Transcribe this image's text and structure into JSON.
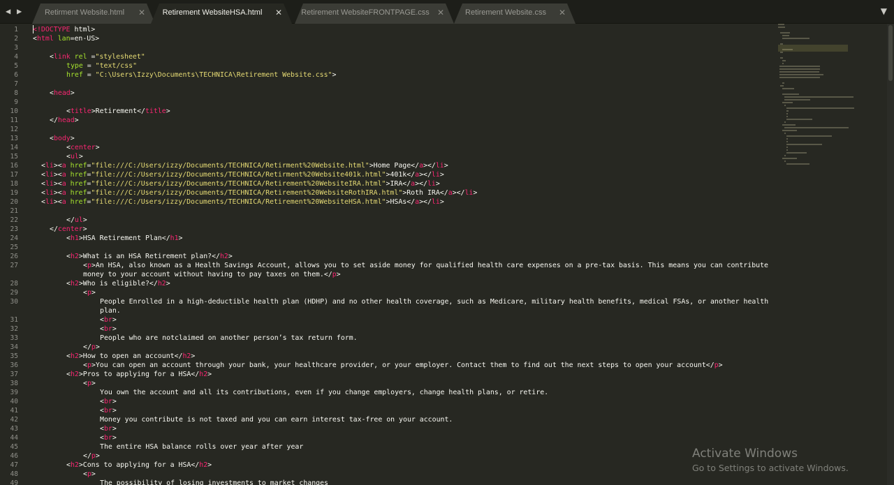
{
  "tabs": [
    {
      "label": "Retirment Website.html",
      "active": false
    },
    {
      "label": "Retirement WebsiteHSA.html",
      "active": true
    },
    {
      "label": "Retirement WebsiteFRONTPAGE.css",
      "active": false
    },
    {
      "label": "Retirement Website.css",
      "active": false
    }
  ],
  "colors": {
    "background": "#272822",
    "tag": "#f92672",
    "string": "#e6db74",
    "attribute": "#a6e22e",
    "text": "#f8f8f2",
    "line_number": "#90908a"
  },
  "icons": {
    "back": "chevron-left-icon",
    "forward": "chevron-right-icon",
    "close": "close-icon",
    "tab_menu": "chevron-down-icon"
  },
  "code_lines": [
    {
      "n": "1",
      "indent": 0,
      "tokens": [
        [
          "t",
          "<!"
        ],
        [
          "t",
          "DOCTYPE"
        ],
        [
          "p",
          " html>"
        ]
      ]
    },
    {
      "n": "2",
      "indent": 0,
      "tokens": [
        [
          "p",
          "<"
        ],
        [
          "t",
          "html"
        ],
        [
          "a",
          " lan"
        ],
        [
          "p",
          "=en-US>"
        ]
      ]
    },
    {
      "n": "3",
      "indent": 0,
      "tokens": []
    },
    {
      "n": "4",
      "indent": 2,
      "tokens": [
        [
          "p",
          "<"
        ],
        [
          "t",
          "link"
        ],
        [
          "a",
          " rel"
        ],
        [
          "p",
          " ="
        ],
        [
          "s",
          "\"stylesheet\""
        ]
      ]
    },
    {
      "n": "5",
      "indent": 4,
      "tokens": [
        [
          "a",
          "type"
        ],
        [
          "p",
          " = "
        ],
        [
          "s",
          "\"text/css\""
        ]
      ]
    },
    {
      "n": "6",
      "indent": 4,
      "tokens": [
        [
          "a",
          "href"
        ],
        [
          "p",
          " = "
        ],
        [
          "s",
          "\"C:\\Users\\Izzy\\Documents\\TECHNICA\\Retirement Website.css\""
        ],
        [
          "p",
          ">"
        ]
      ]
    },
    {
      "n": "7",
      "indent": 0,
      "tokens": []
    },
    {
      "n": "8",
      "indent": 2,
      "tokens": [
        [
          "p",
          "<"
        ],
        [
          "t",
          "head"
        ],
        [
          "p",
          ">"
        ]
      ]
    },
    {
      "n": "9",
      "indent": 0,
      "tokens": []
    },
    {
      "n": "10",
      "indent": 4,
      "tokens": [
        [
          "p",
          "<"
        ],
        [
          "t",
          "title"
        ],
        [
          "p",
          ">Retirement</"
        ],
        [
          "t",
          "title"
        ],
        [
          "p",
          ">"
        ]
      ]
    },
    {
      "n": "11",
      "indent": 2,
      "tokens": [
        [
          "p",
          "</"
        ],
        [
          "t",
          "head"
        ],
        [
          "p",
          ">"
        ]
      ]
    },
    {
      "n": "12",
      "indent": 0,
      "tokens": []
    },
    {
      "n": "13",
      "indent": 2,
      "tokens": [
        [
          "p",
          "<"
        ],
        [
          "t",
          "body"
        ],
        [
          "p",
          ">"
        ]
      ]
    },
    {
      "n": "14",
      "indent": 4,
      "tokens": [
        [
          "p",
          "<"
        ],
        [
          "t",
          "center"
        ],
        [
          "p",
          ">"
        ]
      ]
    },
    {
      "n": "15",
      "indent": 4,
      "tokens": [
        [
          "p",
          "<"
        ],
        [
          "t",
          "ul"
        ],
        [
          "p",
          ">"
        ]
      ]
    },
    {
      "n": "16",
      "indent": 1,
      "tokens": [
        [
          "p",
          "<"
        ],
        [
          "t",
          "li"
        ],
        [
          "p",
          "><"
        ],
        [
          "t",
          "a"
        ],
        [
          "a",
          " href"
        ],
        [
          "p",
          "="
        ],
        [
          "s",
          "\"file:///C:/Users/izzy/Documents/TECHNICA/Retirment%20Website.html\""
        ],
        [
          "p",
          ">Home Page</"
        ],
        [
          "t",
          "a"
        ],
        [
          "p",
          "></"
        ],
        [
          "t",
          "li"
        ],
        [
          "p",
          ">"
        ]
      ]
    },
    {
      "n": "17",
      "indent": 1,
      "tokens": [
        [
          "p",
          "<"
        ],
        [
          "t",
          "li"
        ],
        [
          "p",
          "><"
        ],
        [
          "t",
          "a"
        ],
        [
          "a",
          " href"
        ],
        [
          "p",
          "="
        ],
        [
          "s",
          "\"file:///C:/Users/izzy/Documents/TECHNICA/Retirment%20Website401k.html\""
        ],
        [
          "p",
          ">401k</"
        ],
        [
          "t",
          "a"
        ],
        [
          "p",
          "></"
        ],
        [
          "t",
          "li"
        ],
        [
          "p",
          ">"
        ]
      ]
    },
    {
      "n": "18",
      "indent": 1,
      "tokens": [
        [
          "p",
          "<"
        ],
        [
          "t",
          "li"
        ],
        [
          "p",
          "><"
        ],
        [
          "t",
          "a"
        ],
        [
          "a",
          " href"
        ],
        [
          "p",
          "="
        ],
        [
          "s",
          "\"file:///C:/Users/izzy/Documents/TECHNICA/Retirement%20WebsiteIRA.html\""
        ],
        [
          "p",
          ">IRA</"
        ],
        [
          "t",
          "a"
        ],
        [
          "p",
          "></"
        ],
        [
          "t",
          "li"
        ],
        [
          "p",
          ">"
        ]
      ]
    },
    {
      "n": "19",
      "indent": 1,
      "tokens": [
        [
          "p",
          "<"
        ],
        [
          "t",
          "li"
        ],
        [
          "p",
          "><"
        ],
        [
          "t",
          "a"
        ],
        [
          "a",
          " href"
        ],
        [
          "p",
          "="
        ],
        [
          "s",
          "\"file:///C:/Users/izzy/Documents/TECHNICA/Retirement%20WebsiteRothIRA.html\""
        ],
        [
          "p",
          ">Roth IRA</"
        ],
        [
          "t",
          "a"
        ],
        [
          "p",
          "></"
        ],
        [
          "t",
          "li"
        ],
        [
          "p",
          ">"
        ]
      ]
    },
    {
      "n": "20",
      "indent": 1,
      "tokens": [
        [
          "p",
          "<"
        ],
        [
          "t",
          "li"
        ],
        [
          "p",
          "><"
        ],
        [
          "t",
          "a"
        ],
        [
          "a",
          " href"
        ],
        [
          "p",
          "="
        ],
        [
          "s",
          "\"file:///C:/Users/izzy/Documents/TECHNICA/Retirement%20WebsiteHSA.html\""
        ],
        [
          "p",
          ">HSAs</"
        ],
        [
          "t",
          "a"
        ],
        [
          "p",
          "></"
        ],
        [
          "t",
          "li"
        ],
        [
          "p",
          ">"
        ]
      ]
    },
    {
      "n": "21",
      "indent": 0,
      "tokens": []
    },
    {
      "n": "22",
      "indent": 4,
      "tokens": [
        [
          "p",
          "</"
        ],
        [
          "t",
          "ul"
        ],
        [
          "p",
          ">"
        ]
      ]
    },
    {
      "n": "23",
      "indent": 2,
      "tokens": [
        [
          "p",
          "</"
        ],
        [
          "t",
          "center"
        ],
        [
          "p",
          ">"
        ]
      ]
    },
    {
      "n": "24",
      "indent": 4,
      "tokens": [
        [
          "p",
          "<"
        ],
        [
          "t",
          "h1"
        ],
        [
          "p",
          ">HSA Retirement Plan</"
        ],
        [
          "t",
          "h1"
        ],
        [
          "p",
          ">"
        ]
      ]
    },
    {
      "n": "25",
      "indent": 0,
      "tokens": []
    },
    {
      "n": "26",
      "indent": 4,
      "tokens": [
        [
          "p",
          "<"
        ],
        [
          "t",
          "h2"
        ],
        [
          "p",
          ">What is an HSA Retirement plan?</"
        ],
        [
          "t",
          "h2"
        ],
        [
          "p",
          ">"
        ]
      ]
    },
    {
      "n": "27",
      "indent": 6,
      "tokens": [
        [
          "p",
          "<"
        ],
        [
          "t",
          "p"
        ],
        [
          "p",
          ">An HSA, also known as a Health Savings Account, allows you to set aside money for qualified health care expenses on a pre-tax basis. This means you can contribute"
        ]
      ]
    },
    {
      "n": "",
      "indent": 6,
      "tokens": [
        [
          "p",
          "money to your account without having to pay taxes on them.</"
        ],
        [
          "t",
          "p"
        ],
        [
          "p",
          ">"
        ]
      ]
    },
    {
      "n": "28",
      "indent": 4,
      "tokens": [
        [
          "p",
          "<"
        ],
        [
          "t",
          "h2"
        ],
        [
          "p",
          ">Who is eligible?</"
        ],
        [
          "t",
          "h2"
        ],
        [
          "p",
          ">"
        ]
      ]
    },
    {
      "n": "29",
      "indent": 6,
      "tokens": [
        [
          "p",
          "<"
        ],
        [
          "t",
          "p"
        ],
        [
          "p",
          ">"
        ]
      ]
    },
    {
      "n": "30",
      "indent": 8,
      "tokens": [
        [
          "p",
          "People Enrolled in a high-deductible health plan (HDHP) and no other health coverage, such as Medicare, military health benefits, medical FSAs, or another health"
        ]
      ]
    },
    {
      "n": "",
      "indent": 8,
      "tokens": [
        [
          "p",
          "plan."
        ]
      ]
    },
    {
      "n": "31",
      "indent": 8,
      "tokens": [
        [
          "p",
          "<"
        ],
        [
          "t",
          "br"
        ],
        [
          "p",
          ">"
        ]
      ]
    },
    {
      "n": "32",
      "indent": 8,
      "tokens": [
        [
          "p",
          "<"
        ],
        [
          "t",
          "br"
        ],
        [
          "p",
          ">"
        ]
      ]
    },
    {
      "n": "33",
      "indent": 8,
      "tokens": [
        [
          "p",
          "People who are notclaimed on another person’s tax return form."
        ]
      ]
    },
    {
      "n": "34",
      "indent": 6,
      "tokens": [
        [
          "p",
          "</"
        ],
        [
          "t",
          "p"
        ],
        [
          "p",
          ">"
        ]
      ]
    },
    {
      "n": "35",
      "indent": 4,
      "tokens": [
        [
          "p",
          "<"
        ],
        [
          "t",
          "h2"
        ],
        [
          "p",
          ">How to open an account</"
        ],
        [
          "t",
          "h2"
        ],
        [
          "p",
          ">"
        ]
      ]
    },
    {
      "n": "36",
      "indent": 6,
      "tokens": [
        [
          "p",
          "<"
        ],
        [
          "t",
          "p"
        ],
        [
          "p",
          ">You can open an account through your bank, your healthcare provider, or your employer. Contact them to find out the next steps to open your account</"
        ],
        [
          "t",
          "p"
        ],
        [
          "p",
          ">"
        ]
      ]
    },
    {
      "n": "37",
      "indent": 4,
      "tokens": [
        [
          "p",
          "<"
        ],
        [
          "t",
          "h2"
        ],
        [
          "p",
          ">Pros to applying for a HSA</"
        ],
        [
          "t",
          "h2"
        ],
        [
          "p",
          ">"
        ]
      ]
    },
    {
      "n": "38",
      "indent": 6,
      "tokens": [
        [
          "p",
          "<"
        ],
        [
          "t",
          "p"
        ],
        [
          "p",
          ">"
        ]
      ]
    },
    {
      "n": "39",
      "indent": 8,
      "tokens": [
        [
          "p",
          "You own the account and all its contributions, even if you change employers, change health plans, or retire."
        ]
      ]
    },
    {
      "n": "40",
      "indent": 8,
      "tokens": [
        [
          "p",
          "<"
        ],
        [
          "t",
          "br"
        ],
        [
          "p",
          ">"
        ]
      ]
    },
    {
      "n": "41",
      "indent": 8,
      "tokens": [
        [
          "p",
          "<"
        ],
        [
          "t",
          "br"
        ],
        [
          "p",
          ">"
        ]
      ]
    },
    {
      "n": "42",
      "indent": 8,
      "tokens": [
        [
          "p",
          "Money you contribute is not taxed and you can earn interest tax-free on your account."
        ]
      ]
    },
    {
      "n": "43",
      "indent": 8,
      "tokens": [
        [
          "p",
          "<"
        ],
        [
          "t",
          "br"
        ],
        [
          "p",
          ">"
        ]
      ]
    },
    {
      "n": "44",
      "indent": 8,
      "tokens": [
        [
          "p",
          "<"
        ],
        [
          "t",
          "br"
        ],
        [
          "p",
          ">"
        ]
      ]
    },
    {
      "n": "45",
      "indent": 8,
      "tokens": [
        [
          "p",
          "The entire HSA balance rolls over year after year"
        ]
      ]
    },
    {
      "n": "46",
      "indent": 6,
      "tokens": [
        [
          "p",
          "</"
        ],
        [
          "t",
          "p"
        ],
        [
          "p",
          ">"
        ]
      ]
    },
    {
      "n": "47",
      "indent": 4,
      "tokens": [
        [
          "p",
          "<"
        ],
        [
          "t",
          "h2"
        ],
        [
          "p",
          ">Cons to applying for a HSA</"
        ],
        [
          "t",
          "h2"
        ],
        [
          "p",
          ">"
        ]
      ]
    },
    {
      "n": "48",
      "indent": 6,
      "tokens": [
        [
          "p",
          "<"
        ],
        [
          "t",
          "p"
        ],
        [
          "p",
          ">"
        ]
      ]
    },
    {
      "n": "49",
      "indent": 8,
      "tokens": [
        [
          "p",
          "The possibility of losing investments to market changes"
        ]
      ]
    }
  ],
  "watermark": {
    "title": "Activate Windows",
    "subtitle": "Go to Settings to activate Windows."
  }
}
